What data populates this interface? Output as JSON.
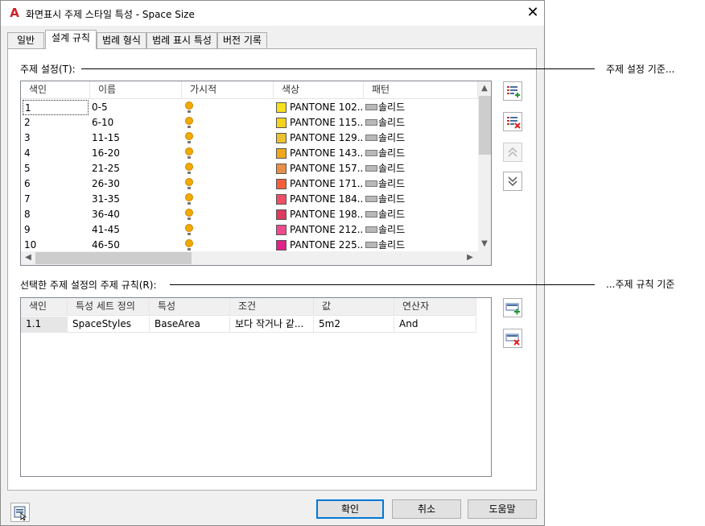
{
  "window": {
    "title": "화면표시 주제 스타일 특성 - Space Size",
    "close_glyph": "✕",
    "logo_letter": "A"
  },
  "tabs": [
    {
      "label": "일반",
      "active": false
    },
    {
      "label": "설계 규칙",
      "active": true
    },
    {
      "label": "범례 형식",
      "active": false
    },
    {
      "label": "범례 표시 특성",
      "active": false
    },
    {
      "label": "버전 기록",
      "active": false
    }
  ],
  "theme_settings": {
    "label": "주제 설정(T):",
    "callout": "주제 설정 기준...",
    "columns": [
      "색인",
      "이름",
      "가시적",
      "색상",
      "패턴"
    ],
    "rows": [
      {
        "index": "1",
        "name": "0-5",
        "color_name": "PANTONE 102...",
        "color": "#f7e11e",
        "pattern": "솔리드"
      },
      {
        "index": "2",
        "name": "6-10",
        "color_name": "PANTONE 115...",
        "color": "#f5d21c",
        "pattern": "솔리드"
      },
      {
        "index": "3",
        "name": "11-15",
        "color_name": "PANTONE 129...",
        "color": "#edc030",
        "pattern": "솔리드"
      },
      {
        "index": "4",
        "name": "16-20",
        "color_name": "PANTONE 143...",
        "color": "#f0a81a",
        "pattern": "솔리드"
      },
      {
        "index": "5",
        "name": "21-25",
        "color_name": "PANTONE 157...",
        "color": "#e8904a",
        "pattern": "솔리드"
      },
      {
        "index": "6",
        "name": "26-30",
        "color_name": "PANTONE 171...",
        "color": "#f5603a",
        "pattern": "솔리드"
      },
      {
        "index": "7",
        "name": "31-35",
        "color_name": "PANTONE 184...",
        "color": "#ef4e66",
        "pattern": "솔리드"
      },
      {
        "index": "8",
        "name": "36-40",
        "color_name": "PANTONE 198...",
        "color": "#dc3a5e",
        "pattern": "솔리드"
      },
      {
        "index": "9",
        "name": "41-45",
        "color_name": "PANTONE 212...",
        "color": "#ef4a8f",
        "pattern": "솔리드"
      },
      {
        "index": "10",
        "name": "46-50",
        "color_name": "PANTONE 225...",
        "color": "#e0228a",
        "pattern": "솔리드"
      }
    ]
  },
  "rules": {
    "label": "선택한 주제 설정의 주제 규칙(R):",
    "callout": "...주제 규칙 기준",
    "columns": [
      "색인",
      "특성 세트 정의",
      "특성",
      "조건",
      "값",
      "연산자"
    ],
    "rows": [
      {
        "index": "1.1",
        "set": "SpaceStyles",
        "property": "BaseArea",
        "condition": "보다 작거나 같...",
        "value": "5m2",
        "operator": "And"
      }
    ]
  },
  "buttons": {
    "ok": "확인",
    "cancel": "취소",
    "help": "도움말"
  },
  "icons": {
    "add_setting": "add-list-icon",
    "remove_setting": "remove-list-icon",
    "move_up": "double-chevron-up-icon",
    "move_down": "double-chevron-down-icon",
    "add_rule": "add-rule-icon",
    "remove_rule": "remove-rule-icon",
    "preview": "preview-icon"
  }
}
